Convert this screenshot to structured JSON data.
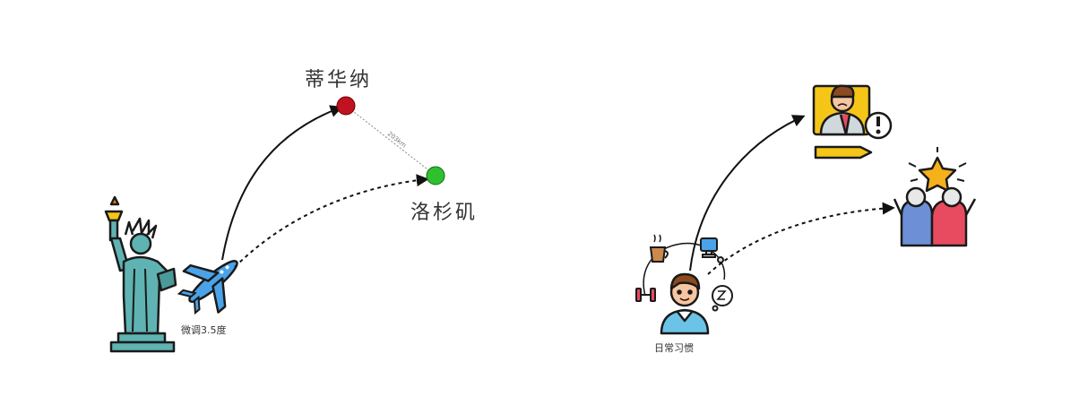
{
  "left_panel": {
    "city_a": "蒂华纳",
    "city_b": "洛杉矶",
    "distance": "203km",
    "adjust_label": "微调3.5度",
    "colors": {
      "city_a": "#c1121f",
      "city_b": "#2fbf2f"
    }
  },
  "right_panel": {
    "habits_label": "日常习惯"
  }
}
